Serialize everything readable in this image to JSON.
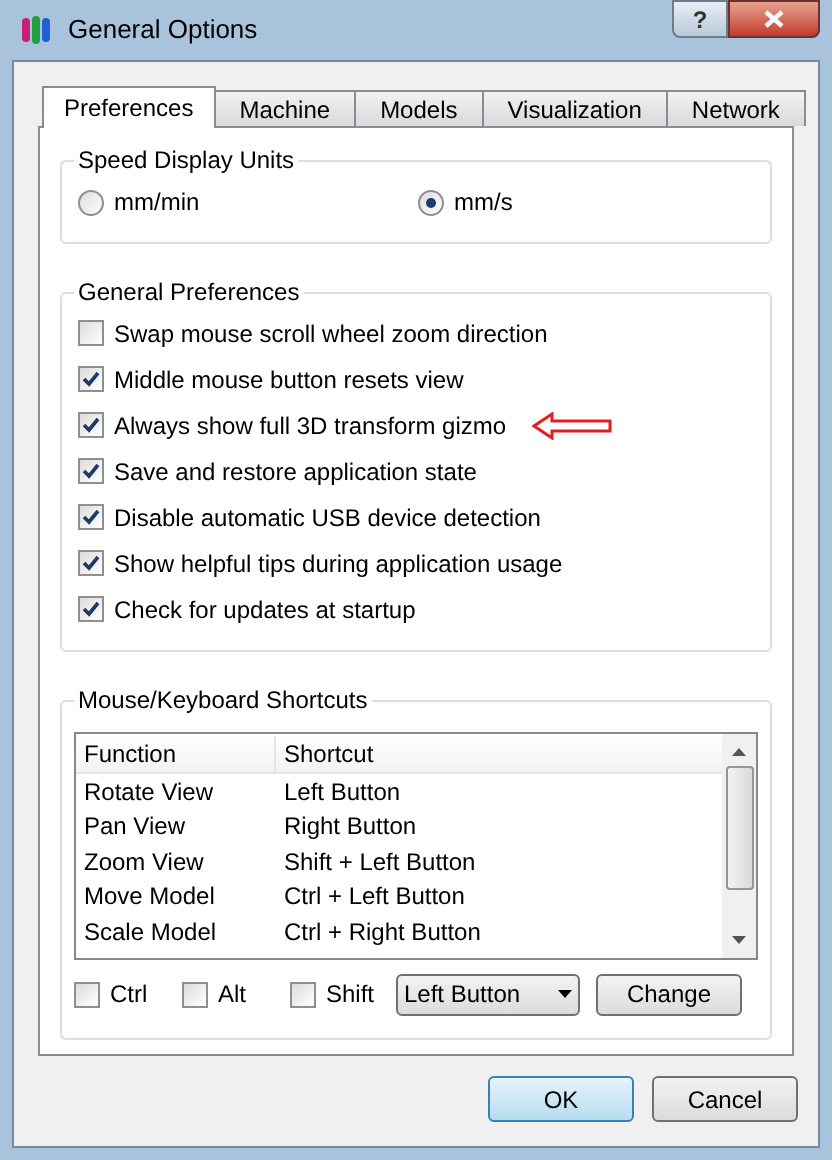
{
  "window": {
    "title": "General Options",
    "help_button": "?"
  },
  "tabs": [
    {
      "label": "Preferences",
      "selected": true
    },
    {
      "label": "Machine",
      "selected": false
    },
    {
      "label": "Models",
      "selected": false
    },
    {
      "label": "Visualization",
      "selected": false
    },
    {
      "label": "Network",
      "selected": false
    }
  ],
  "speed_units": {
    "title": "Speed Display Units",
    "options": [
      {
        "label": "mm/min",
        "selected": false
      },
      {
        "label": "mm/s",
        "selected": true
      }
    ]
  },
  "general_preferences": {
    "title": "General Preferences",
    "items": [
      {
        "label": "Swap mouse scroll wheel zoom direction",
        "checked": false
      },
      {
        "label": "Middle mouse button resets view",
        "checked": true
      },
      {
        "label": "Always show full 3D transform gizmo",
        "checked": true,
        "annotated": true
      },
      {
        "label": "Save and restore application state",
        "checked": true
      },
      {
        "label": "Disable automatic USB device detection",
        "checked": true
      },
      {
        "label": "Show helpful tips during application usage",
        "checked": true
      },
      {
        "label": "Check for updates at startup",
        "checked": true
      }
    ]
  },
  "shortcuts": {
    "title": "Mouse/Keyboard Shortcuts",
    "columns": [
      "Function",
      "Shortcut"
    ],
    "rows": [
      [
        "Rotate View",
        "Left Button"
      ],
      [
        "Pan View",
        "Right Button"
      ],
      [
        "Zoom View",
        "Shift + Left Button"
      ],
      [
        "Move Model",
        "Ctrl + Left Button"
      ],
      [
        "Scale Model",
        "Ctrl + Right Button"
      ]
    ],
    "modifiers": [
      {
        "label": "Ctrl",
        "checked": false
      },
      {
        "label": "Alt",
        "checked": false
      },
      {
        "label": "Shift",
        "checked": false
      }
    ],
    "button_select": "Left Button",
    "change_button": "Change"
  },
  "buttons": [
    {
      "label": "OK",
      "default": true
    },
    {
      "label": "Cancel",
      "default": false
    }
  ]
}
